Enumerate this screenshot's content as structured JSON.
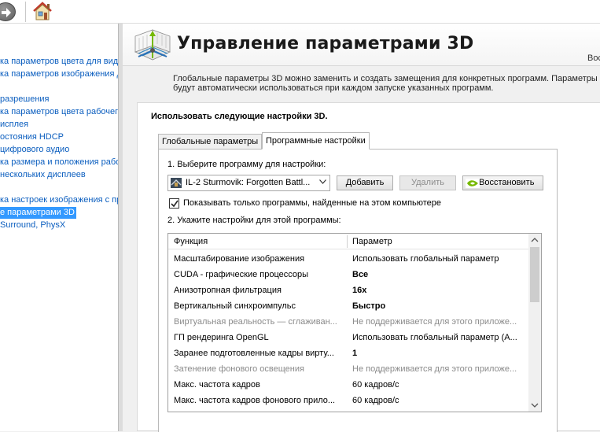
{
  "toolbar": {
    "back_icon": "back-arrow-icon",
    "home_icon": "home-icon"
  },
  "leftpane": {
    "header": "",
    "items": [
      {
        "label": "ка параметров цвета для вид"
      },
      {
        "label": "ка параметров изображения д"
      },
      {
        "label": "разрешения"
      },
      {
        "label": "ка параметров цвета рабочег"
      },
      {
        "label": "исплея"
      },
      {
        "label": "остояния HDCP"
      },
      {
        "label": "цифрового аудио"
      },
      {
        "label": "ка размера и положения рабо"
      },
      {
        "label": "нескольких дисплеев"
      },
      {
        "label": "ка настроек изображения с пр"
      },
      {
        "label": "е параметрами 3D"
      },
      {
        "label": "Surround, PhysX"
      }
    ]
  },
  "banner": {
    "title": "Управление параметрами 3D",
    "right_text": "Вос"
  },
  "description": {
    "line1": "Глобальные параметры 3D можно заменить и создать замещения для конкретных программ. Параметры",
    "line2": "будут автоматически использоваться при каждом запуске указанных программ."
  },
  "panel": {
    "title": "Использовать следующие настройки 3D.",
    "tabs": [
      {
        "label": "Глобальные параметры"
      },
      {
        "label": "Программные настройки"
      }
    ],
    "step1_label": "1. Выберите программу для настройки:",
    "program_select": {
      "value": "IL-2 Sturmovik: Forgotten Battl..."
    },
    "buttons": {
      "add": "Добавить",
      "remove": "Удалить",
      "restore": "Восстановить"
    },
    "show_only_checkbox": {
      "label": "Показывать только программы, найденные на этом компьютере",
      "checked": true
    },
    "step2_label": "2. Укажите настройки для этой программы:",
    "grid": {
      "columns": [
        "Функция",
        "Параметр"
      ],
      "rows": [
        {
          "feature": "Масштабирование изображения",
          "value": "Использовать глобальный параметр",
          "bold": false,
          "dim": false
        },
        {
          "feature": "CUDA - графические процессоры",
          "value": "Все",
          "bold": true,
          "dim": false
        },
        {
          "feature": "Анизотропная фильтрация",
          "value": "16x",
          "bold": true,
          "dim": false
        },
        {
          "feature": "Вертикальный синхроимпульс",
          "value": "Быстро",
          "bold": true,
          "dim": false
        },
        {
          "feature": "Виртуальная реальность — сглаживан...",
          "value": "Не поддерживается для этого приложе...",
          "bold": false,
          "dim": true
        },
        {
          "feature": "ГП рендеринга OpenGL",
          "value": "Использовать глобальный параметр (А...",
          "bold": false,
          "dim": false
        },
        {
          "feature": "Заранее подготовленные кадры вирту...",
          "value": "1",
          "bold": true,
          "dim": false
        },
        {
          "feature": "Затенение фонового освещения",
          "value": "Не поддерживается для этого приложе...",
          "bold": false,
          "dim": true
        },
        {
          "feature": "Макс. частота кадров",
          "value": "60 кадров/с",
          "bold": false,
          "dim": false
        },
        {
          "feature": "Макс. частота кадров фонового прило...",
          "value": "60 кадров/с",
          "bold": false,
          "dim": false
        }
      ]
    }
  }
}
